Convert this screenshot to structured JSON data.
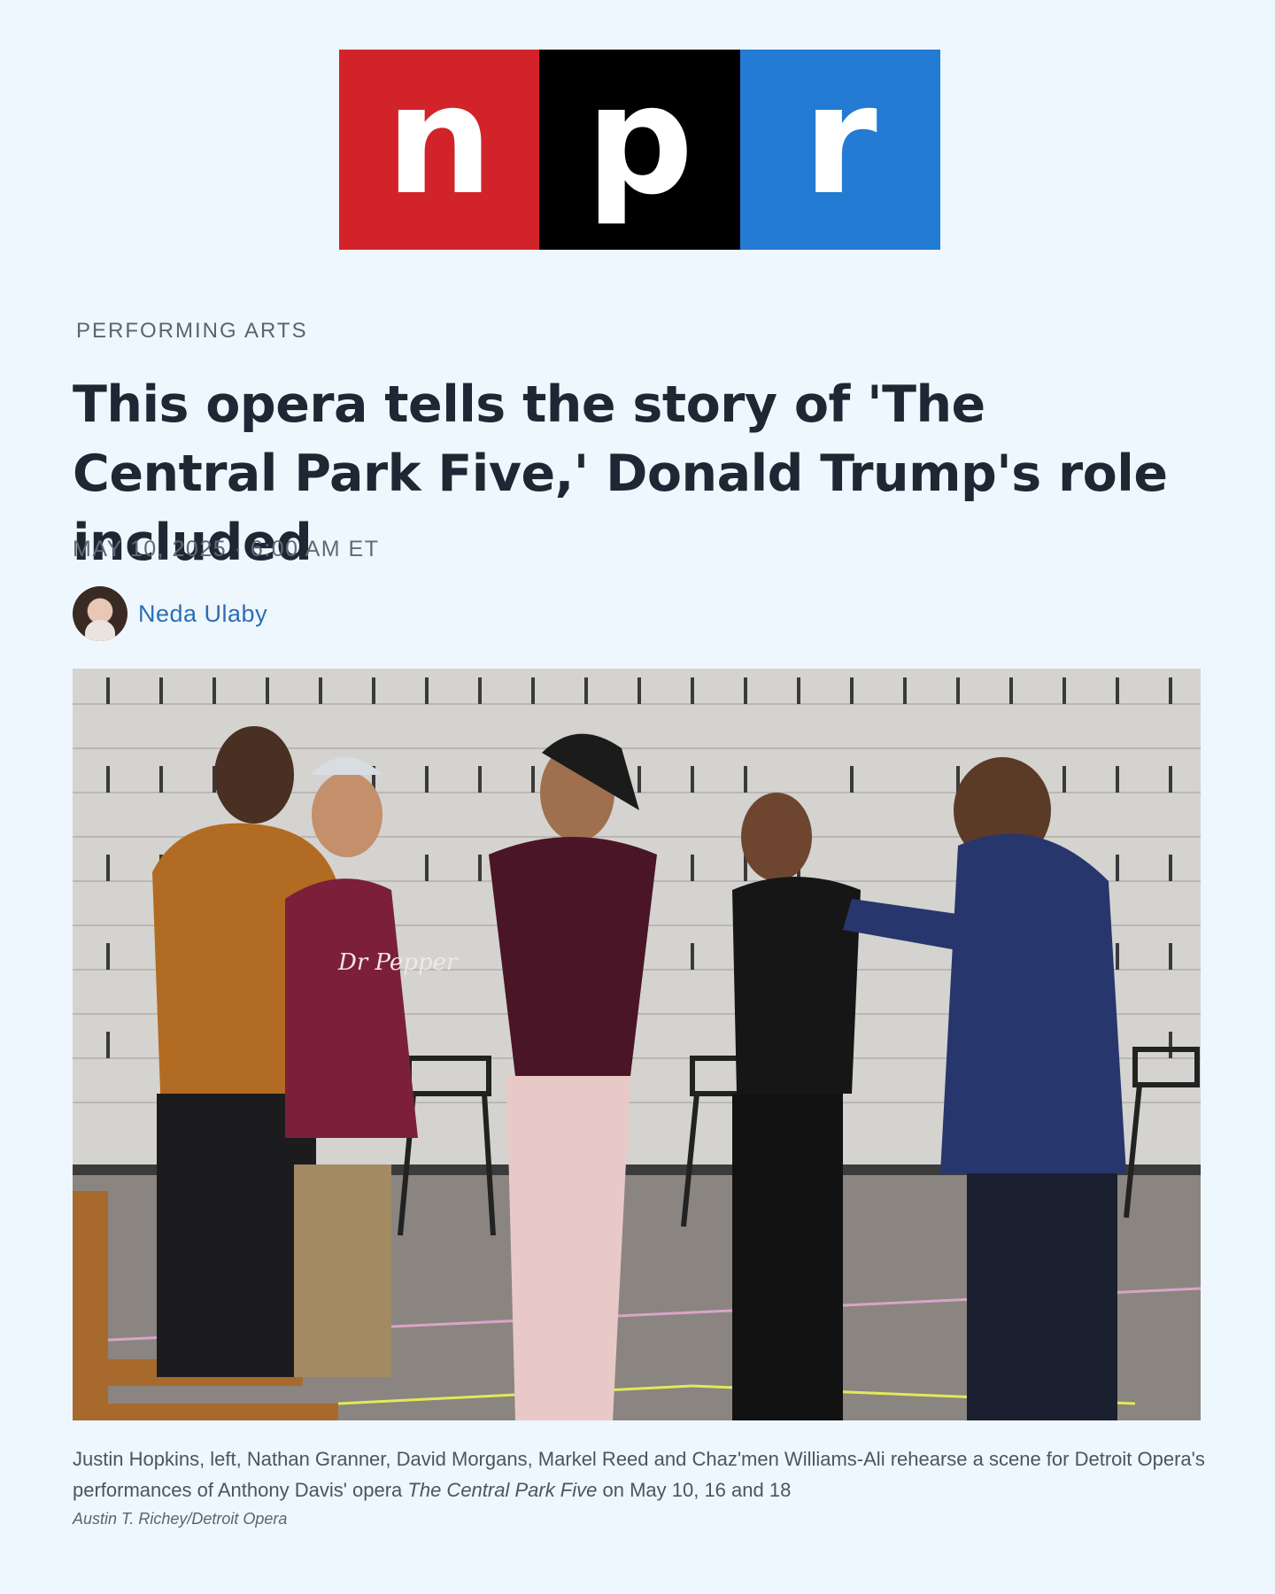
{
  "logo": {
    "letters": [
      "n",
      "p",
      "r"
    ],
    "colors": [
      "#d2232a",
      "#000000",
      "#237bd3"
    ]
  },
  "article": {
    "section": "PERFORMING ARTS",
    "headline": "This opera tells the story of 'The Central Park Five,' Donald Trump's role included",
    "dateline": "MAY 10, 2025 · 6:00 AM ET",
    "author": "Neda Ulaby"
  },
  "photo": {
    "shirt_text": "Dr Pepper"
  },
  "caption": {
    "before": "Justin Hopkins, left, Nathan Granner, David Morgans, Markel Reed and Chaz'men Williams-Ali rehearse a scene for Detroit Opera's performances of Anthony Davis' opera ",
    "title": "The Central Park Five",
    "after": " on May 10, 16 and 18",
    "credit": "Austin T. Richey/Detroit Opera"
  },
  "colors": {
    "background": "#eef7fd",
    "link": "#2e6db4"
  }
}
